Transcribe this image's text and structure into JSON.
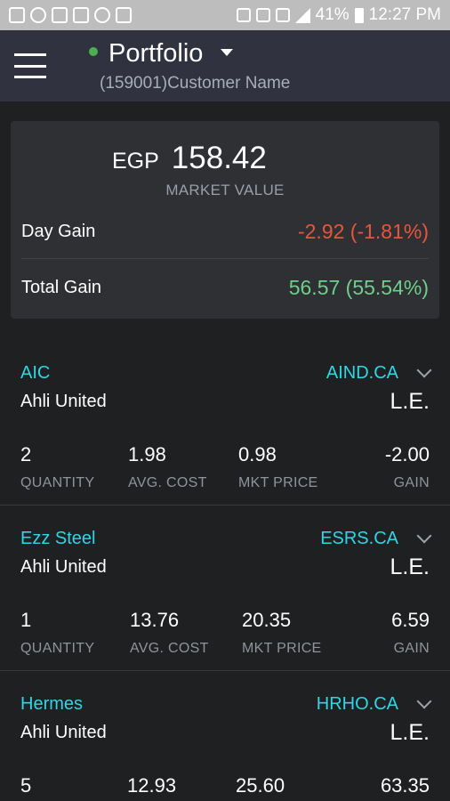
{
  "status_bar": {
    "battery": "41%",
    "time": "12:27 PM",
    "left_icons": [
      "mail-icon",
      "whatsapp-icon",
      "news-icon",
      "image-icon",
      "sync-icon",
      "clipboard-icon"
    ],
    "right_icons": [
      "vibrate-icon",
      "shield-icon",
      "no-sim-icon",
      "signal-icon",
      "battery-icon"
    ]
  },
  "header": {
    "title": "Portfolio",
    "account_id": "(159001)",
    "customer_name": "Customer Name",
    "status_color": "#4caf50"
  },
  "summary": {
    "currency": "EGP",
    "market_value": "158.42",
    "market_value_label": "MARKET VALUE",
    "day_gain_label": "Day Gain",
    "day_gain_value": "-2.92 (-1.81%)",
    "total_gain_label": "Total Gain",
    "total_gain_value": "56.57 (55.54%)"
  },
  "labels": {
    "quantity": "QUANTITY",
    "avg_cost": "AVG. COST",
    "mkt_price": "MKT PRICE",
    "gain": "GAIN"
  },
  "holdings": [
    {
      "name": "AIC",
      "symbol": "AIND.CA",
      "broker": "Ahli United",
      "currency": "L.E.",
      "quantity": "2",
      "avg_cost": "1.98",
      "mkt_price": "0.98",
      "gain": "-2.00"
    },
    {
      "name": "Ezz Steel",
      "symbol": "ESRS.CA",
      "broker": "Ahli United",
      "currency": "L.E.",
      "quantity": "1",
      "avg_cost": "13.76",
      "mkt_price": "20.35",
      "gain": "6.59"
    },
    {
      "name": "Hermes",
      "symbol": "HRHO.CA",
      "broker": "Ahli United",
      "currency": "L.E.",
      "quantity": "5",
      "avg_cost": "12.93",
      "mkt_price": "25.60",
      "gain": "63.35"
    }
  ],
  "colors": {
    "accent": "#2fd6e6",
    "negative": "#e8553d",
    "positive": "#6fcf8a",
    "appbar": "#30323f",
    "background": "#1f2022"
  }
}
